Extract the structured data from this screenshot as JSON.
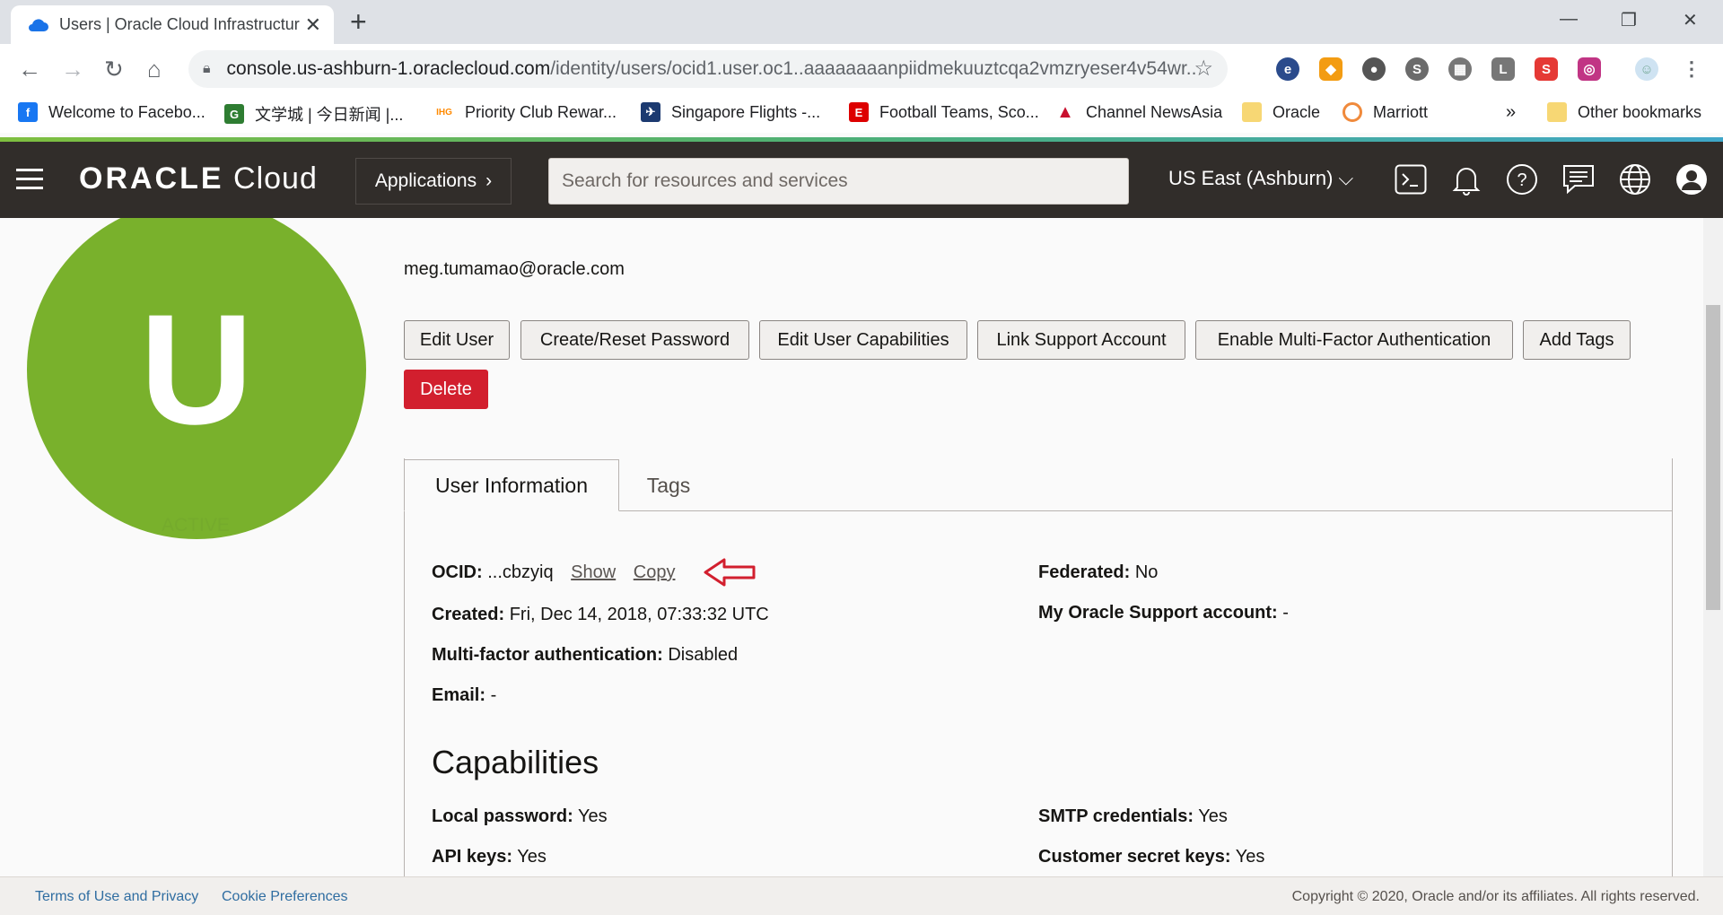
{
  "browser": {
    "tab_title": "Users | Oracle Cloud Infrastructur",
    "url_host": "console.us-ashburn-1.oraclecloud.com",
    "url_path": "/identity/users/ocid1.user.oc1..aaaaaaaanpiidmekuuztcqa2vmzryeser4v54wr...",
    "bookmarks": [
      {
        "label": "Welcome to Facebo...",
        "icon": "facebook-icon",
        "color": "#1877f2"
      },
      {
        "label": "文学城 | 今日新闻 |...",
        "icon": "wenxuecheng-icon",
        "color": "#2e7d32"
      },
      {
        "label": "Priority Club Rewar...",
        "icon": "ihg-icon",
        "color": "#ff8a00"
      },
      {
        "label": "Singapore Flights -...",
        "icon": "singapore-air-icon",
        "color": "#1c3a70"
      },
      {
        "label": "Football Teams, Sco...",
        "icon": "espn-icon",
        "color": "#d00"
      },
      {
        "label": "Channel NewsAsia",
        "icon": "cna-icon",
        "color": "#c8102e"
      },
      {
        "label": "Oracle",
        "icon": "folder-icon",
        "color": "#f7d774"
      },
      {
        "label": "Marriott",
        "icon": "marriott-icon",
        "color": "#f08a3c"
      }
    ],
    "more_bookmarks": "»",
    "other_bookmarks": "Other bookmarks"
  },
  "header": {
    "logo_brand": "ORACLE",
    "logo_product": "Cloud",
    "applications": "Applications",
    "search_placeholder": "Search for resources and services",
    "region": "US East (Ashburn)"
  },
  "user": {
    "avatar_letter": "U",
    "status": "ACTIVE",
    "email": "meg.tumamao@oracle.com"
  },
  "actions": {
    "edit_user": "Edit User",
    "reset_password": "Create/Reset Password",
    "edit_capabilities": "Edit User Capabilities",
    "link_support": "Link Support Account",
    "enable_mfa": "Enable Multi-Factor Authentication",
    "add_tags": "Add Tags",
    "delete": "Delete"
  },
  "tabs": {
    "user_information": "User Information",
    "tags": "Tags"
  },
  "info": {
    "ocid_label": "OCID:",
    "ocid_value": "...cbzyiq",
    "show": "Show",
    "copy": "Copy",
    "created_label": "Created:",
    "created_value": "Fri, Dec 14, 2018, 07:33:32 UTC",
    "mfa_label": "Multi-factor authentication:",
    "mfa_value": "Disabled",
    "email_label": "Email:",
    "email_value": "-",
    "federated_label": "Federated:",
    "federated_value": "No",
    "support_label": "My Oracle Support account:",
    "support_value": "-"
  },
  "capabilities": {
    "heading": "Capabilities",
    "local_password_label": "Local password:",
    "local_password_value": "Yes",
    "api_keys_label": "API keys:",
    "api_keys_value": "Yes",
    "smtp_label": "SMTP credentials:",
    "smtp_value": "Yes",
    "secret_keys_label": "Customer secret keys:",
    "secret_keys_value": "Yes"
  },
  "footer": {
    "terms": "Terms of Use and Privacy",
    "cookies": "Cookie Preferences",
    "copyright": "Copyright © 2020, Oracle and/or its affiliates. All rights reserved."
  }
}
